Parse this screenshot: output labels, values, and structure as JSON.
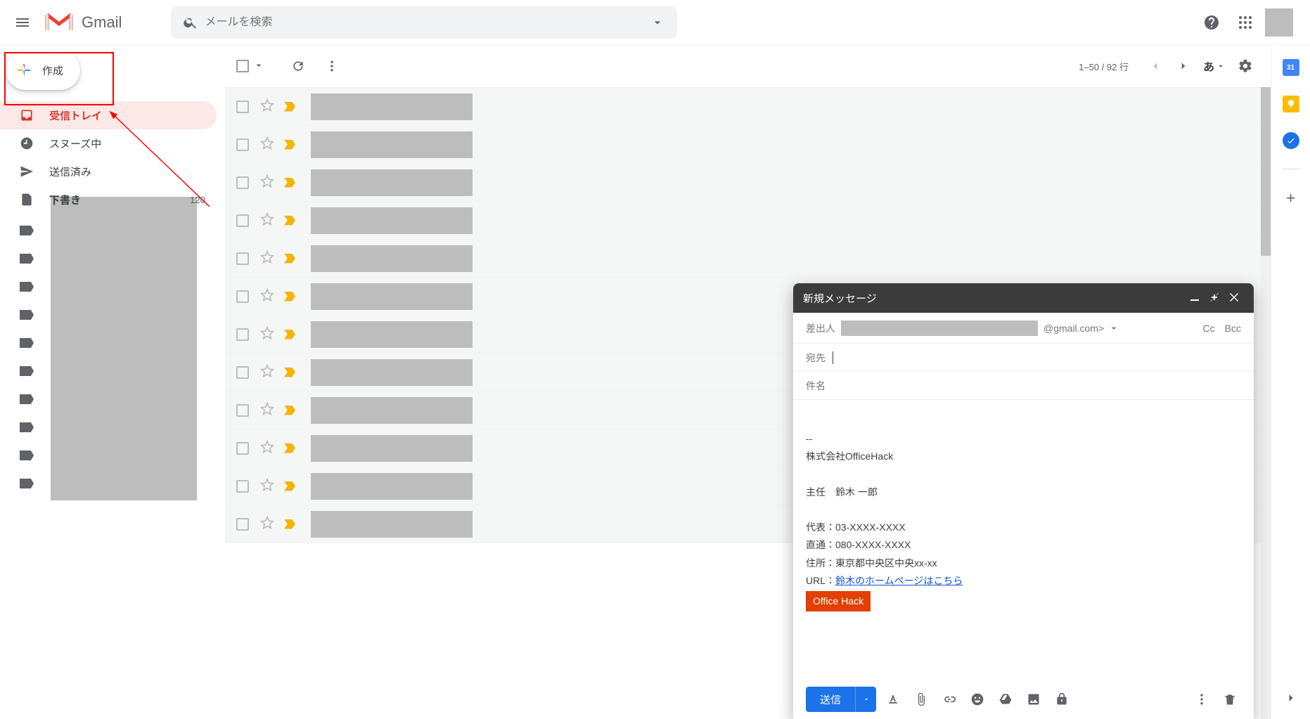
{
  "header": {
    "app_name": "Gmail",
    "search_placeholder": "メールを検索"
  },
  "sidebar": {
    "compose_label": "作成",
    "items": [
      {
        "label": "受信トレイ",
        "count": ""
      },
      {
        "label": "スヌーズ中",
        "count": ""
      },
      {
        "label": "送信済み",
        "count": ""
      },
      {
        "label": "下書き",
        "count": "120"
      }
    ],
    "label_count": 10
  },
  "toolbar": {
    "page_count": "1–50 / 92 行",
    "lang_indicator": "あ"
  },
  "list": {
    "row_count": 12
  },
  "compose_window": {
    "title": "新規メッセージ",
    "from_label": "差出人",
    "from_domain": "@gmail.com>",
    "to_label": "宛先",
    "cc_label": "Cc",
    "bcc_label": "Bcc",
    "subject_placeholder": "件名",
    "body": {
      "sep": "--",
      "company": "株式会社OfficeHack",
      "role_name": "主任　鈴木 一郎",
      "tel_main": "代表：03-XXXX-XXXX",
      "tel_direct": "直通：080-XXXX-XXXX",
      "address": "住所：東京都中央区中央xx-xx",
      "url_label": "URL：",
      "url_text": "鈴木のホームページはこちら",
      "badge": "Office Hack"
    },
    "send_label": "送信"
  },
  "rightpanel": {
    "calendar_day": "31"
  }
}
